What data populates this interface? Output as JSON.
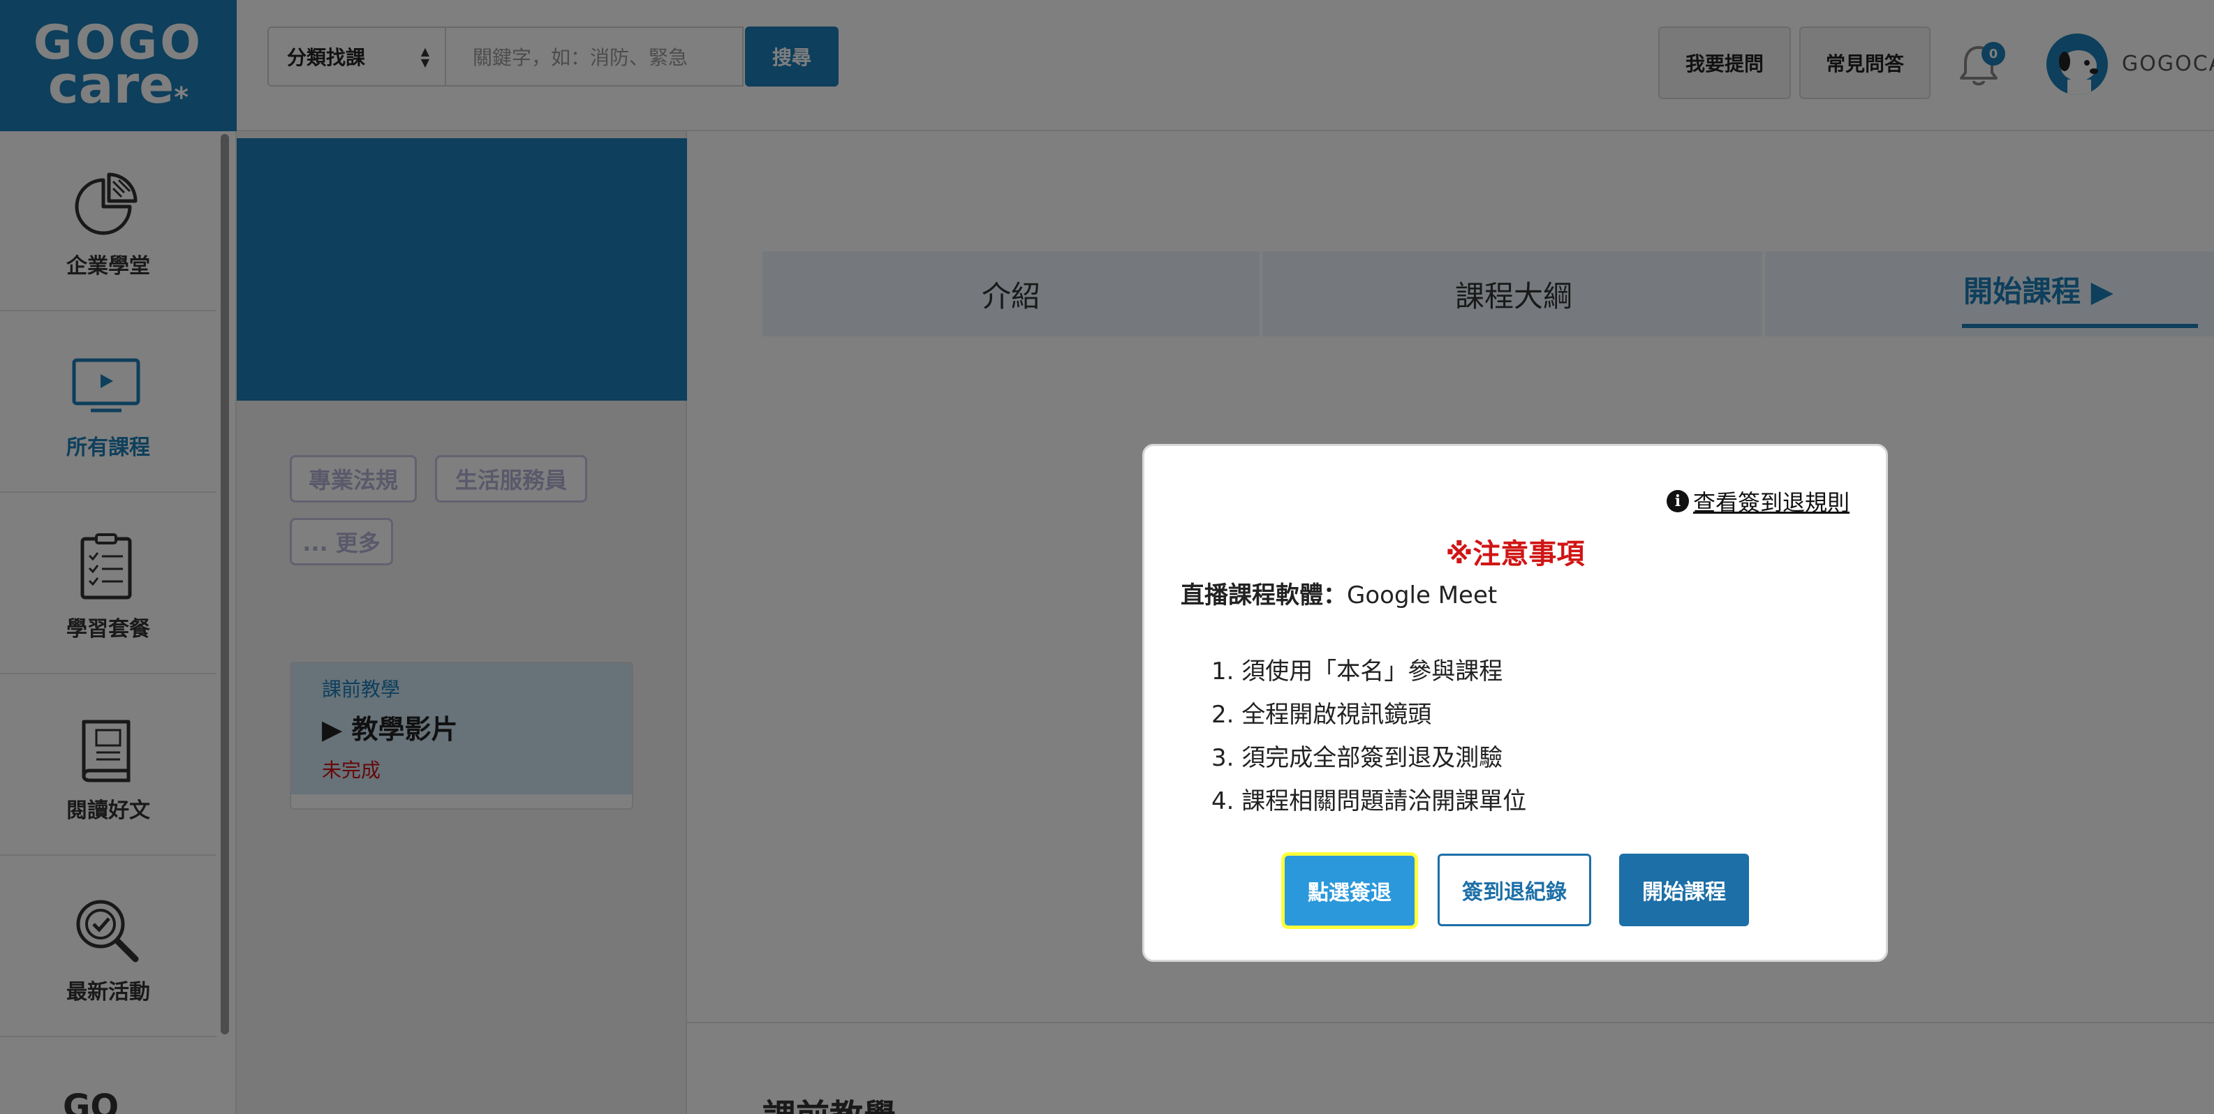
{
  "logo": {
    "line1": "GOGO",
    "line2": "care",
    "mark": "*"
  },
  "header": {
    "category_label": "分類找課",
    "search_placeholder": "關鍵字，如：消防、緊急",
    "search_button": "搜尋",
    "ask_button": "我要提問",
    "faq_button": "常見問答",
    "notification_count": "0",
    "username": "GOGOCA"
  },
  "sidebar": {
    "items": [
      {
        "label": "企業學堂",
        "icon": "pie-chart-icon"
      },
      {
        "label": "所有課程",
        "icon": "monitor-play-icon",
        "active": true
      },
      {
        "label": "學習套餐",
        "icon": "checklist-icon"
      },
      {
        "label": "閱讀好文",
        "icon": "book-icon"
      },
      {
        "label": "最新活動",
        "icon": "magnifier-check-icon"
      }
    ],
    "bottom_text": "GO"
  },
  "course": {
    "tags": [
      "專業法規",
      "生活服務員",
      "... 更多"
    ],
    "lesson": {
      "section": "課前教學",
      "title": "教學影片",
      "status": "未完成"
    }
  },
  "tabs": [
    {
      "label": "介紹"
    },
    {
      "label": "課程大綱"
    },
    {
      "label": "開始課程",
      "active": true
    }
  ],
  "bottom_heading": "課前教學",
  "modal": {
    "rules_link": "查看簽到退規則",
    "notice_title": "※注意事項",
    "software_label": "直播課程軟體：",
    "software_value": "Google Meet",
    "rules": [
      "1. 須使用「本名」參與課程",
      "2. 全程開啟視訊鏡頭",
      "3. 須完成全部簽到退及測驗",
      "4. 課程相關問題請洽開課單位"
    ],
    "buttons": {
      "checkout": "點選簽退",
      "record": "簽到退紀錄",
      "start": "開始課程"
    }
  },
  "colors": {
    "brand": "#1c7fb8",
    "alert": "#d01515",
    "highlight": "#ffff3c"
  }
}
